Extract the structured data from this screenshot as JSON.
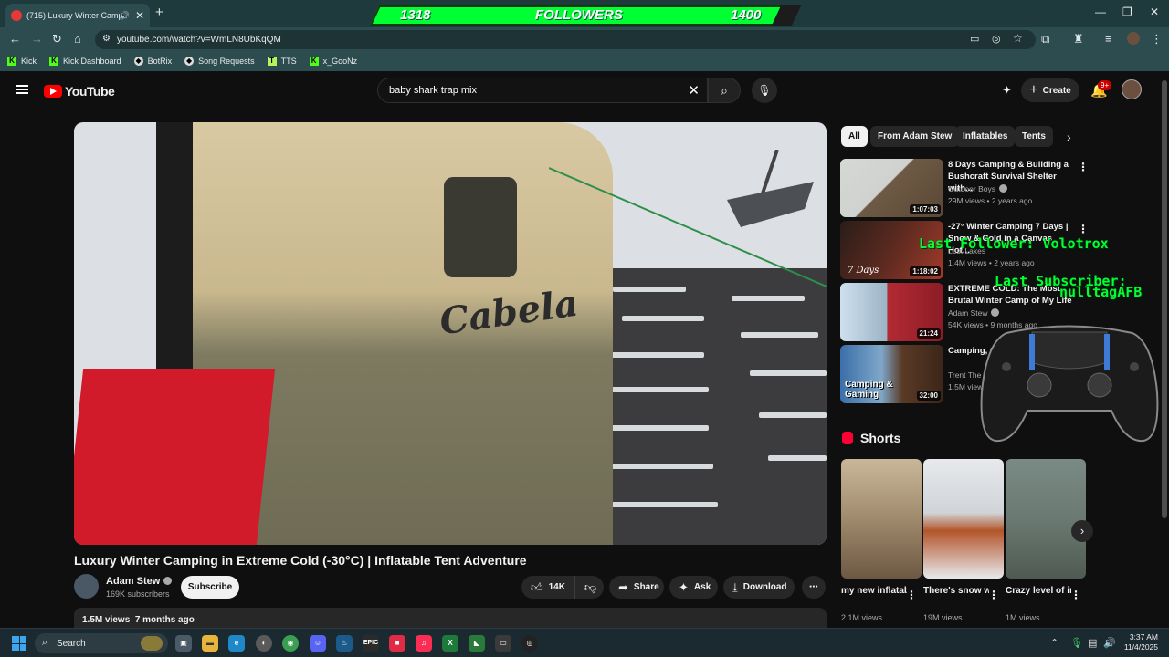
{
  "browser": {
    "tab_title": "(715) Luxury Winter Campi",
    "url": "youtube.com/watch?v=WmLN8UbKqQM",
    "new_tab": "+",
    "bookmarks": [
      "Kick",
      "Kick Dashboard",
      "BotRix",
      "Song Requests",
      "TTS",
      "x_GooNz"
    ]
  },
  "stream_overlay": {
    "followers_current": "1318",
    "followers_label": "FOLLOWERS",
    "followers_goal": "1400",
    "last_follower": "Last Follower: Volotrox",
    "last_subscriber_label": "Last Subscriber:",
    "last_subscriber_name": "nulltagAFB"
  },
  "youtube": {
    "logo": "YouTube",
    "search_value": "baby shark trap mix",
    "create_label": "Create",
    "notifications_badge": "9+",
    "video": {
      "title": "Luxury Winter Camping in Extreme Cold (-30°C) | Inflatable Tent Adventure",
      "channel": "Adam Stew",
      "subscribers": "169K subscribers",
      "subscribe_label": "Subscribe",
      "likes": "14K",
      "share_label": "Share",
      "ask_label": "Ask",
      "download_label": "Download",
      "views": "1.5M views",
      "age": "7 months ago",
      "frame_text": "Cabela"
    },
    "chips": [
      "All",
      "From Adam Stew",
      "Inflatables",
      "Tents"
    ],
    "recommendations": [
      {
        "title": "8 Days Camping & Building a Bushcraft Survival Shelter with...",
        "channel": "Outdoor Boys",
        "meta": "29M views • 2 years ago",
        "duration": "1:07:03",
        "thumb_colors": [
          "#d6d8d6",
          "#6e5a44"
        ]
      },
      {
        "title": "-27° Winter Camping 7 Days | Snow & Cold in a Canvas Hot...",
        "channel": "Lost Lakes",
        "meta": "1.4M views • 2 years ago",
        "duration": "1:18:02",
        "thumb_text": "7 Days",
        "thumb_colors": [
          "#2a1d18",
          "#a33a2a"
        ]
      },
      {
        "title": "EXTREME COLD: The Most Brutal Winter Camp of My Life",
        "channel": "Adam Stew",
        "meta": "54K views • 9 months ago",
        "duration": "21:24",
        "thumb_colors": [
          "#cfe0ee",
          "#b22a34"
        ]
      },
      {
        "title": "Camping, C... a Van (Driv...",
        "channel": "Trent The T...",
        "meta": "1.5M views",
        "duration": "32:00",
        "thumb_text": "Camping & Gaming",
        "thumb_colors": [
          "#3a6fa8",
          "#5a3a26"
        ]
      }
    ],
    "shorts_title": "Shorts",
    "shorts": [
      {
        "title": "my new inflatable ...",
        "views": "2.1M views",
        "colors": [
          "#c9b79a",
          "#6d5844"
        ]
      },
      {
        "title": "There's snow way I'm ...",
        "views": "19M views",
        "colors": [
          "#e7e9ec",
          "#b3552a"
        ]
      },
      {
        "title": "Crazy level of inflatabl...",
        "views": "1M views",
        "colors": [
          "#7a8a84",
          "#4f5a52"
        ]
      }
    ]
  },
  "taskbar": {
    "search_label": "Search",
    "time": "3:37 AM",
    "date": "11/4/2025"
  },
  "colors": {
    "accent_red": "#ff0000",
    "overlay_green": "#00ff33",
    "kick_green": "#53fc18"
  }
}
